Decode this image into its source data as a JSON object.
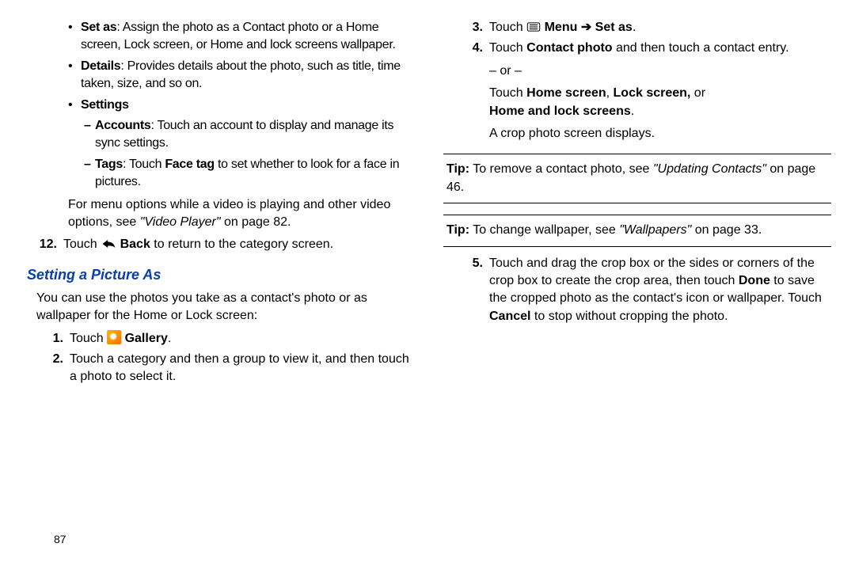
{
  "page_number": "87",
  "left": {
    "bullets": {
      "setas_label": "Set as",
      "setas_text": ": Assign the photo as a Contact photo or a Home screen, Lock screen, or Home and lock screens wallpaper.",
      "details_label": "Details",
      "details_text": ": Provides details about the photo, such as title, time taken, size, and so on.",
      "settings_label": "Settings",
      "accounts_label": "Accounts",
      "accounts_text": ": Touch an account to display and manage its sync settings.",
      "tags_label": "Tags",
      "tags_mid": ": Touch ",
      "tags_bold": "Face tag",
      "tags_text": " to set whether to look for a face in pictures."
    },
    "video_note_a": "For menu options while a video is playing and other video options, see ",
    "video_note_ital": "\"Video Player\"",
    "video_note_b": " on page 82.",
    "step12_prefix": "Touch ",
    "step12_bold": " Back",
    "step12_suffix": " to return to the category screen.",
    "heading": "Setting a Picture As",
    "intro": "You can use the photos you take as a contact's photo or as wallpaper for the Home or Lock screen:",
    "step1_prefix": "Touch ",
    "step1_bold": " Gallery",
    "step1_suffix": ".",
    "step2": "Touch a category and then a group to view it, and then touch a photo to select it.",
    "num12": "12.",
    "num1": "1.",
    "num2": "2."
  },
  "right": {
    "num3": "3.",
    "num4": "4.",
    "num5": "5.",
    "step3_prefix": "Touch ",
    "step3_menu": " Menu ",
    "step3_arrow": "➔ ",
    "step3_setas": "Set as",
    "step3_suffix": ".",
    "step4_a": "Touch ",
    "step4_b": "Contact photo",
    "step4_c": " and then touch a contact entry.",
    "or": "– or –",
    "step4_d": "Touch ",
    "step4_e": "Home screen",
    "step4_f": ", ",
    "step4_g": "Lock screen,",
    "step4_h": " or ",
    "step4_i": "Home and lock screens",
    "step4_j": ".",
    "crop": "A crop photo screen displays.",
    "tip1_a": "Tip:",
    "tip1_b": " To remove a contact photo, see ",
    "tip1_c": "\"Updating Contacts\"",
    "tip1_d": " on page 46.",
    "tip2_a": "Tip:",
    "tip2_b": " To change wallpaper, see ",
    "tip2_c": "\"Wallpapers\"",
    "tip2_d": " on page 33.",
    "step5_a": "Touch and drag the crop box or the sides or corners of the crop box to create the crop area, then touch ",
    "step5_b": "Done",
    "step5_c": " to save the cropped photo as the contact's icon or wallpaper. Touch ",
    "step5_d": "Cancel",
    "step5_e": " to stop without cropping the photo."
  }
}
